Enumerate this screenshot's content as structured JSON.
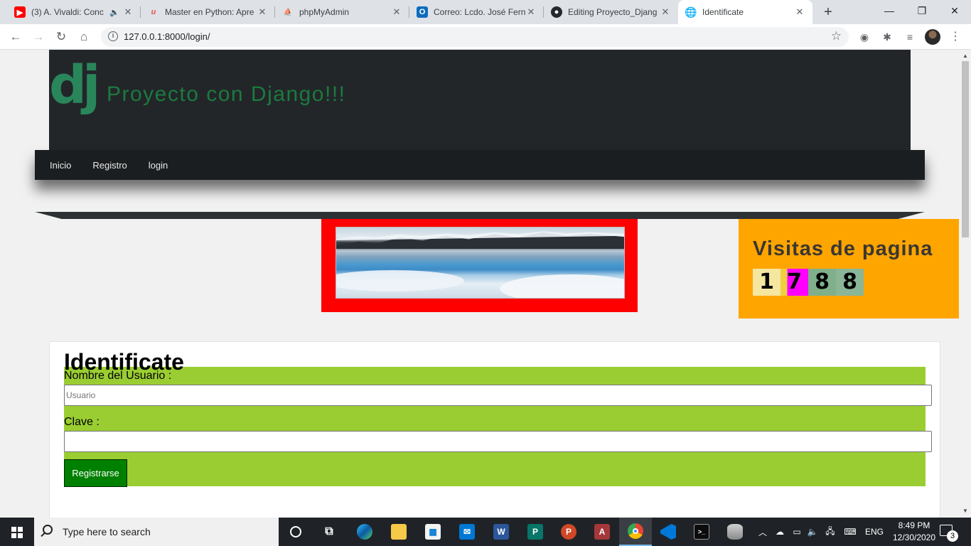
{
  "browser": {
    "tabs": [
      {
        "title": "(3) A. Vivaldi: Conc",
        "icon": "youtube-icon",
        "color": "#ff0000",
        "muted": true
      },
      {
        "title": "Master en Python: Apre",
        "icon": "udemy-icon",
        "color": "#ec5252"
      },
      {
        "title": "phpMyAdmin",
        "icon": "phpmyadmin-icon",
        "color": "#f89c0e"
      },
      {
        "title": "Correo: Lcdo. José Fern",
        "icon": "outlook-icon",
        "color": "#0f6cbd"
      },
      {
        "title": "Editing Proyecto_Djang",
        "icon": "github-icon",
        "color": "#24292e"
      },
      {
        "title": "Identificate",
        "icon": "globe-icon",
        "color": "#5f6368",
        "active": true
      }
    ],
    "url": "127.0.0.1:8000/login/"
  },
  "site": {
    "logo_text": "dj",
    "title": "Proyecto con Django!!!",
    "nav": [
      "Inicio",
      "Registro",
      "login"
    ],
    "visits_label": "Visitas de pagina",
    "visits_digits": [
      "1",
      "7",
      "8",
      "8"
    ],
    "colors": {
      "header_bg": "#222629",
      "banner_frame": "#ff0000",
      "visits_bg": "#ffa500",
      "form_bg": "#9acd32",
      "button_bg": "#008000"
    }
  },
  "login_form": {
    "title": "Identificate",
    "username_label": "Nombre del Usuario :",
    "username_placeholder": "Usuario",
    "username_value": "",
    "password_label": "Clave :",
    "password_value": "",
    "submit_label": "Registrarse"
  },
  "taskbar": {
    "search_placeholder": "Type here to search",
    "language": "ENG",
    "time": "8:49 PM",
    "date": "12/30/2020",
    "notifications": "3"
  }
}
